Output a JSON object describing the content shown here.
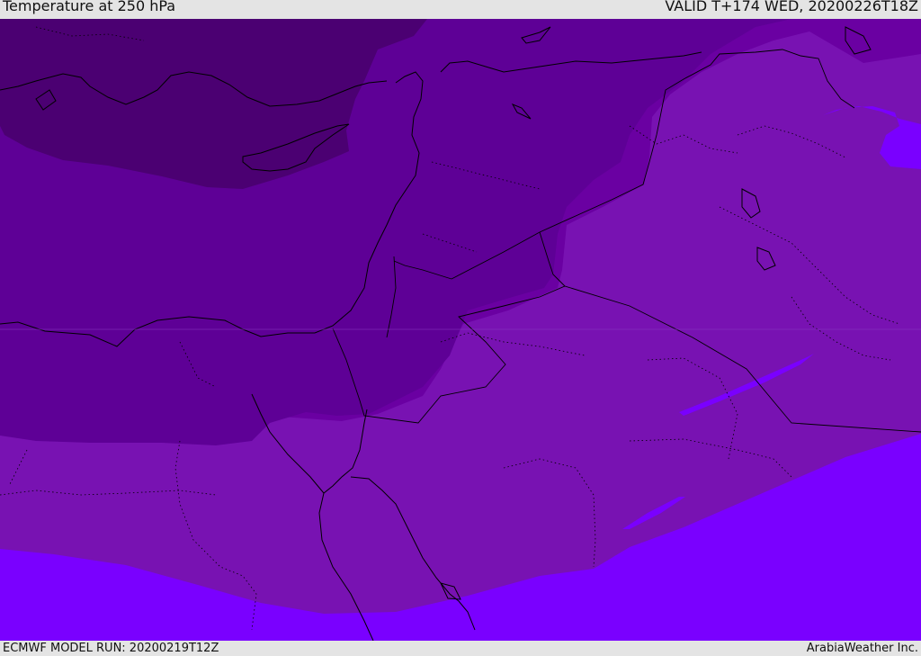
{
  "header": {
    "title": "Temperature at 250 hPa",
    "valid": "VALID T+174 WED, 20200226T18Z"
  },
  "footer": {
    "model_run": "ECMWF MODEL RUN: 20200219T12Z",
    "credit": "ArabiaWeather Inc."
  },
  "map": {
    "field": "temperature",
    "level": "250 hPa",
    "colors": {
      "coldest": "#4b0072",
      "cold": "#5e0096",
      "cool": "#6a00a2",
      "mild": "#7812b2",
      "warm": "#7a00ff",
      "coastline": "#000000",
      "border": "#000000"
    }
  }
}
